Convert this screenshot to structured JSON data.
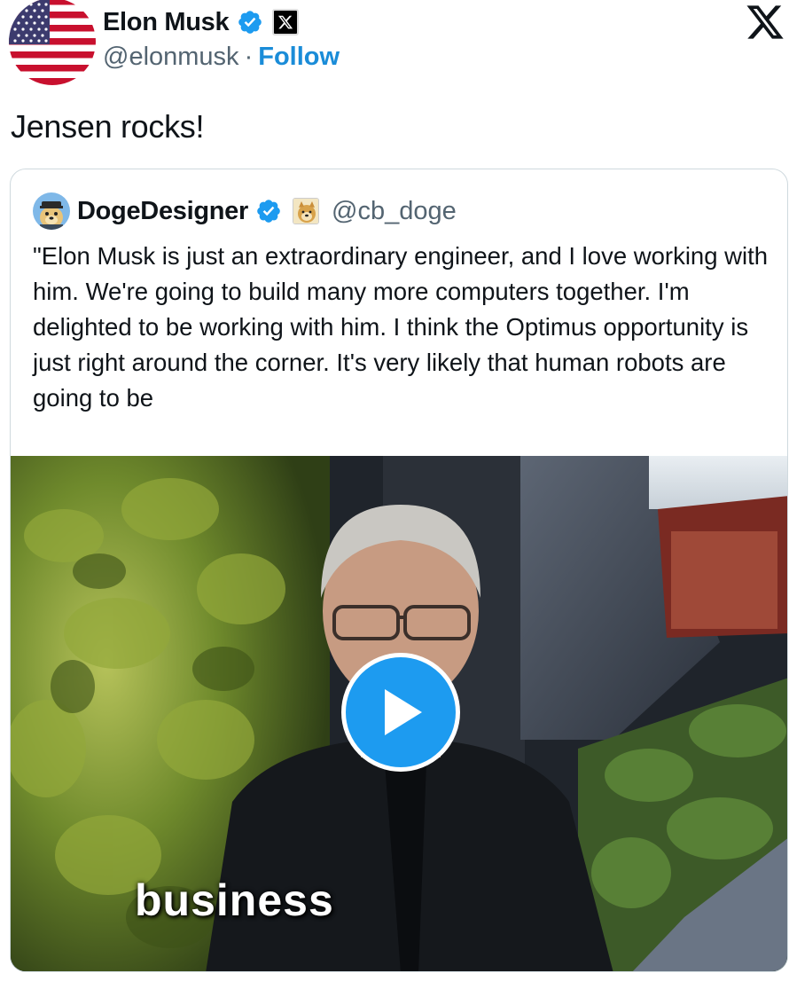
{
  "author": {
    "name": "Elon Musk",
    "handle": "@elonmusk",
    "separator": "·",
    "follow_label": "Follow",
    "avatar_icon": "us-flag-avatar",
    "verified_color": "#1d9bf0"
  },
  "tweet": {
    "text": "Jensen rocks!"
  },
  "quoted": {
    "name": "DogeDesigner",
    "handle": "@cb_doge",
    "avatar_icon": "doge-cartoon-avatar",
    "affiliate_icon": "doge-badge-icon",
    "text": "\"Elon Musk is just an extraordinary engineer, and I love working with him. We're going to build many more computers together. I'm delighted to be working with him. I think the Optimus opportunity is just right around the corner. It's very likely that human robots are going to be",
    "video": {
      "caption": "business",
      "play_icon": "play-icon",
      "play_color": "#1d9bf0"
    }
  },
  "colors": {
    "accent": "#1d9bf0",
    "secondary_text": "#536471",
    "border": "#cfd9de"
  }
}
